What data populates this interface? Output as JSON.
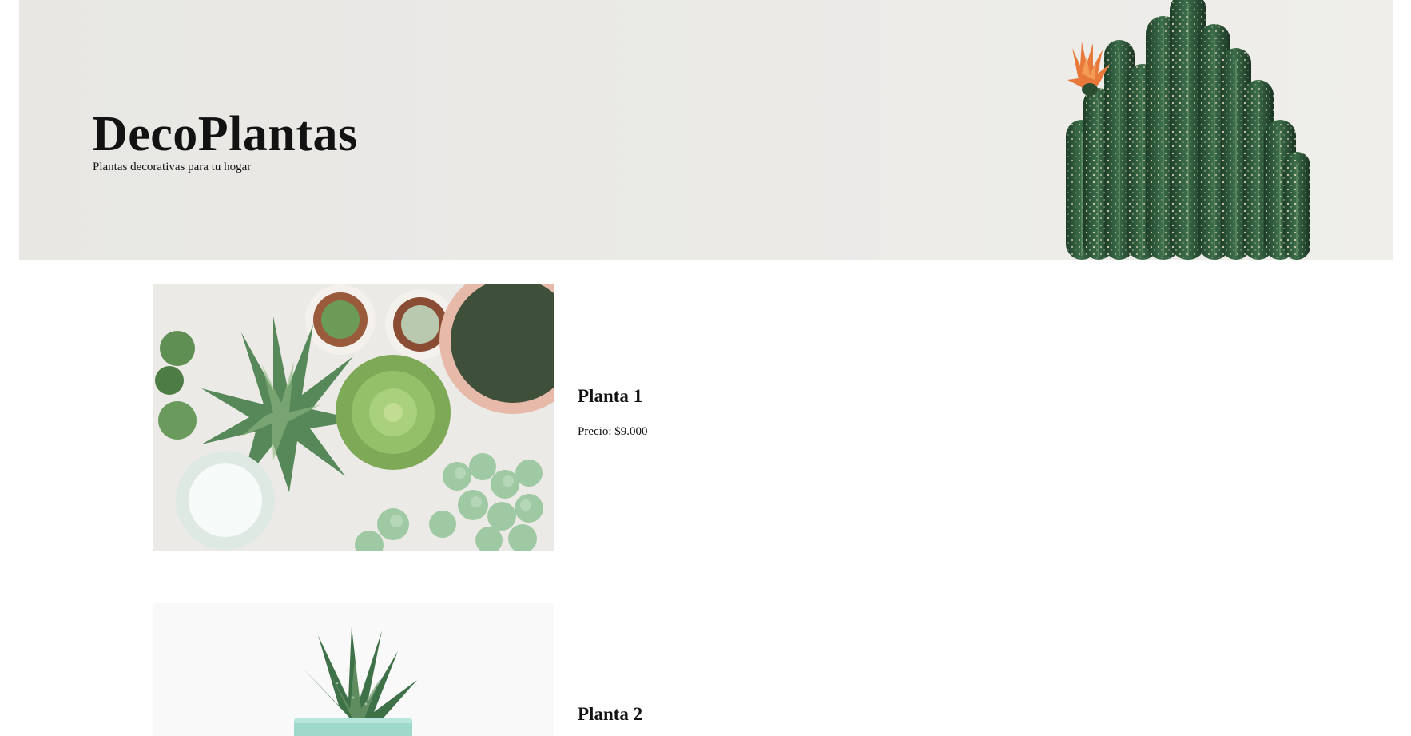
{
  "hero": {
    "title": "DecoPlantas",
    "subtitle": "Plantas decorativas para tu hogar"
  },
  "products": [
    {
      "name": "Planta 1",
      "price": "Precio: $9.000"
    },
    {
      "name": "Planta 2"
    }
  ],
  "colors": {
    "hero_background": "#e9e8e5",
    "cactus_green": "#2f5a3d",
    "flower_orange": "#e8793a",
    "pot_mint": "#9ed9cc",
    "succulent_green": "#8bbf6a",
    "page_background": "#ffffff"
  }
}
